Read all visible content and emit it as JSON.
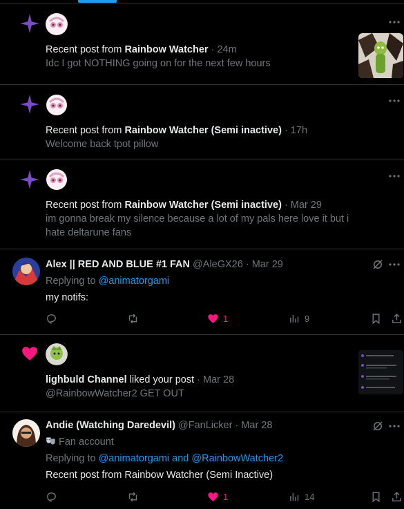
{
  "notifications": [
    {
      "type": "new-post",
      "prefix": "Recent post from ",
      "author": "Rainbow Watcher",
      "time": "· 24m",
      "body": "Idc I got NOTHING going on for the next few hours"
    },
    {
      "type": "new-post",
      "prefix": "Recent post from ",
      "author": "Rainbow Watcher (Semi inactive)",
      "time": "· 17h",
      "body": "Welcome back tpot pillow"
    },
    {
      "type": "new-post",
      "prefix": "Recent post from ",
      "author": "Rainbow Watcher (Semi inactive)",
      "time": "· Mar 29",
      "body_line1": "im gonna break my silence because a lot of my pals here love it but i",
      "body_line2": "hate deltarune fans"
    }
  ],
  "reply1": {
    "name": "Alex || RED AND BLUE #1 FAN",
    "handle": "@AleGX26",
    "time": "· Mar 29",
    "replying_prefix": "Replying to ",
    "replying_to": "@animatorgami",
    "body": "my notifs:",
    "likes": "1",
    "views": "9"
  },
  "like_notif": {
    "user": "lighbuld Channel",
    "action": " liked your post",
    "time": "· Mar 28",
    "body": "@RainbowWatcher2 GET OUT"
  },
  "reply2": {
    "name": "Andie (Watching Daredevil)",
    "handle": "@FanLicker",
    "time": "· Mar 28",
    "fan_label": "Fan account",
    "replying_prefix": "Replying to ",
    "replying_to": "@animatorgami and @RainbowWatcher2",
    "body": "Recent post from Rainbow Watcher (Semi Inactive)",
    "likes": "1",
    "views": "14"
  },
  "colors": {
    "background": "#000000",
    "divider": "#2f3336",
    "muted": "#71767b",
    "text": "#e7e9ea",
    "link": "#1d9bf0",
    "like_pink": "#f91880",
    "sparkle_purple": "#794bc4"
  }
}
